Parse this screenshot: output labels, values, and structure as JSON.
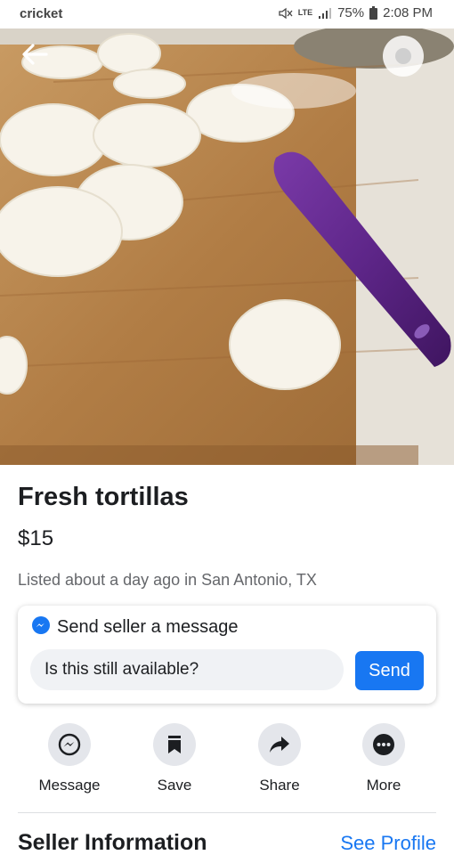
{
  "status_bar": {
    "carrier": "cricket",
    "network": "LTE",
    "battery": "75%",
    "time": "2:08 PM",
    "icons": [
      "mute-icon",
      "signal-icon",
      "battery-icon"
    ]
  },
  "listing": {
    "photo_icons": {
      "back": "back-arrow-icon",
      "overflow": "overflow-menu-icon"
    },
    "title": "Fresh tortillas",
    "price": "$15",
    "listed_meta": "Listed about a day ago in San Antonio, TX"
  },
  "message_card": {
    "icon": "messenger-icon",
    "heading": "Send seller a message",
    "input_value": "Is this still available?",
    "send_label": "Send"
  },
  "actions": [
    {
      "label": "Message",
      "icon": "messenger-icon"
    },
    {
      "label": "Save",
      "icon": "bookmark-icon"
    },
    {
      "label": "Share",
      "icon": "share-arrow-icon"
    },
    {
      "label": "More",
      "icon": "more-dots-icon"
    }
  ],
  "seller": {
    "heading": "Seller Information",
    "link_label": "See Profile"
  },
  "colors": {
    "accent": "#1877f2",
    "text_primary": "#1c1e21",
    "text_secondary": "#65676b",
    "icon_bg": "#e4e6eb"
  }
}
